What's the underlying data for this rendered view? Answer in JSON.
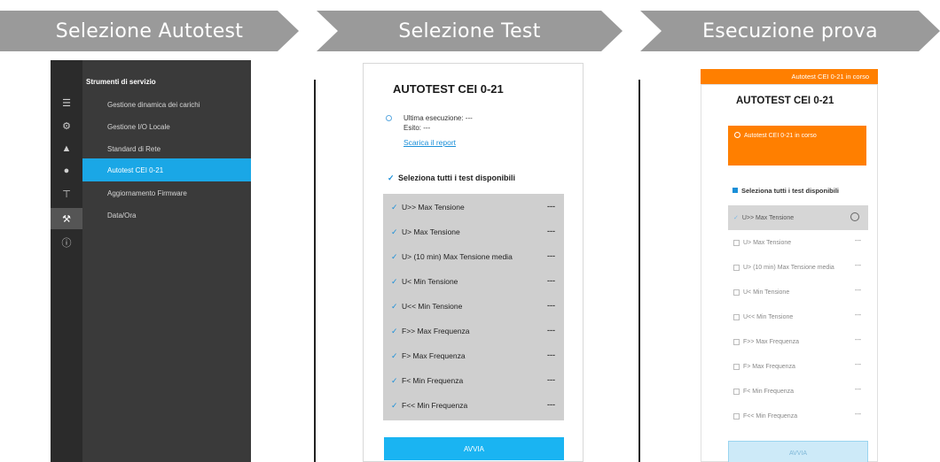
{
  "steps": [
    "Selezione Autotest",
    "Selezione Test",
    "Esecuzione prova"
  ],
  "menu": {
    "title": "Strumenti di servizio",
    "rail_icons": [
      "menu-icon",
      "gear-icon",
      "bell-icon",
      "user-icon",
      "network-icon",
      "wrench-icon",
      "info-icon"
    ],
    "items": [
      "Gestione dinamica dei carichi",
      "Gestione I/O Locale",
      "Standard di Rete",
      "Autotest CEI 0-21",
      "Aggiornamento Firmware",
      "Data/Ora"
    ],
    "active_index": 3
  },
  "test_panel": {
    "title": "AUTOTEST CEI 0-21",
    "last_run": "Ultima esecuzione: ---",
    "result": "Esito: ---",
    "download_link": "Scarica il report",
    "select_all": "Seleziona tutti i test disponibili",
    "tests": [
      "U>> Max Tensione",
      "U> Max Tensione",
      "U> (10 min) Max Tensione media",
      "U< Min Tensione",
      "U<< Min Tensione",
      "F>> Max Frequenza",
      "F> Max Frequenza",
      "F< Min Frequenza",
      "F<< Min Frequenza"
    ],
    "status": "---",
    "start_button": "AVVIA"
  },
  "run_panel": {
    "banner": "Autotest CEI 0-21 in corso",
    "title": "AUTOTEST CEI 0-21",
    "alert": "Autotest CEI 0-21 in corso",
    "select_all": "Seleziona tutti i test disponibili",
    "tests": [
      "U>> Max Tensione",
      "U> Max Tensione",
      "U> (10 min) Max Tensione media",
      "U< Min Tensione",
      "U<< Min Tensione",
      "F>> Max Frequenza",
      "F> Max Frequenza",
      "F< Min Frequenza",
      "F<< Min Frequenza"
    ],
    "status": "---",
    "start_button": "AVVIA"
  },
  "colors": {
    "accent": "#1aa7e6",
    "orange": "#ff7f00",
    "step_grey": "#9a9a9a"
  }
}
